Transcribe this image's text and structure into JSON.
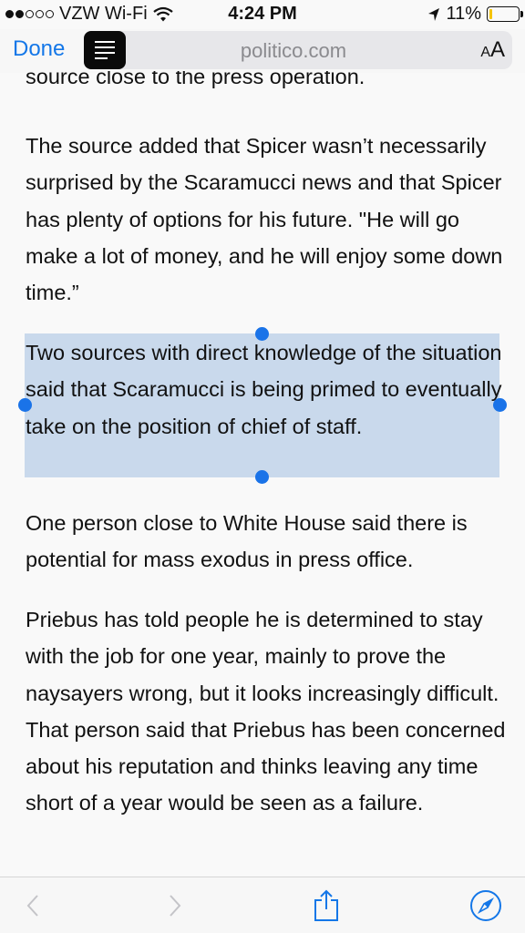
{
  "status": {
    "carrier": "VZW Wi-Fi",
    "time": "4:24 PM",
    "battery": "11%",
    "battery_level": 0.11,
    "signal_bars": 2,
    "signal_total": 5
  },
  "nav": {
    "done_label": "Done",
    "url": "politico.com",
    "text_size_label_small": "A",
    "text_size_label_large": "A"
  },
  "article": {
    "paragraphs": [
      "source close to the press operation.",
      "The source added that Spicer wasn’t necessarily surprised by the Scaramucci news and that Spicer has plenty of options for his future. \"He will go make a lot of money, and he will enjoy some down time.”",
      "Two sources with direct knowledge of the situation said that Scaramucci is being primed to eventually take on the position of chief of staff.",
      "One person close to White House said there is potential for mass exodus in press office.",
      "Priebus has told people he is determined to stay with the job for one year, mainly to prove the naysayers wrong, but it looks increasingly difficult. That person said that Priebus has been concerned about his reputation and thinks leaving any time short of a year would be seen as a failure."
    ]
  },
  "toolbar": {
    "icons": [
      "back-icon",
      "forward-icon",
      "share-icon",
      "safari-compass-icon"
    ]
  },
  "colors": {
    "accent": "#1477e8",
    "selection": "#c9d9ec",
    "battery_low": "#f5c400"
  }
}
